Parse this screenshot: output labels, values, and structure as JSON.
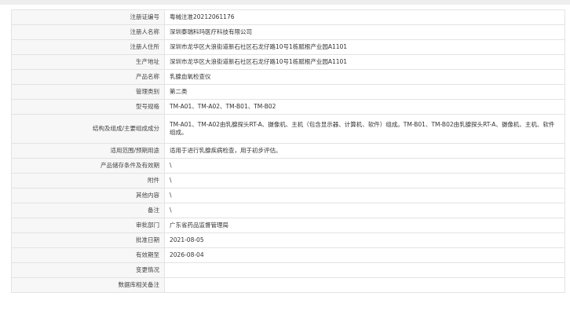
{
  "record": {
    "rows": [
      {
        "label": "注册证编号",
        "value": "粤械注准20212061176"
      },
      {
        "label": "注册人名称",
        "value": "深圳泰瑞科玛医疗科技有限公司"
      },
      {
        "label": "注册人住所",
        "value": "深圳市龙华区大浪街道新石社区石龙仔路10号1栋赋根产业园A1101"
      },
      {
        "label": "生产地址",
        "value": "深圳市龙华区大浪街道新石社区石龙仔路10号1栋赋根产业园A1101"
      },
      {
        "label": "产品名称",
        "value": "乳腺血氧检查仪"
      },
      {
        "label": "管理类别",
        "value": "第二类"
      },
      {
        "label": "型号规格",
        "value": "TM-A01、TM-A02、TM-B01、TM-B02"
      },
      {
        "label": "结构及组成/主要组成成分",
        "value": "TM-A01、TM-A02由乳腺探头RT-A、摄像机、主机（包含显示器、计算机、软件）组成。TM-B01、TM-B02由乳腺探头RT-A、摄像机、主机、软件组成。"
      },
      {
        "label": "适用范围/预期用途",
        "value": "适用于进行乳腺疾病检查，用于初步评估。"
      },
      {
        "label": "产品储存条件及有效期",
        "value": "\\"
      },
      {
        "label": "附件",
        "value": "\\"
      },
      {
        "label": "其他内容",
        "value": "\\"
      },
      {
        "label": "备注",
        "value": "\\"
      },
      {
        "label": "审批部门",
        "value": "广东省药品监督管理局"
      },
      {
        "label": "批准日期",
        "value": "2021-08-05"
      },
      {
        "label": "有效期至",
        "value": "2026-08-04"
      },
      {
        "label": "变更情况",
        "value": ""
      },
      {
        "label": "数据库相关备注",
        "value": ""
      }
    ]
  }
}
